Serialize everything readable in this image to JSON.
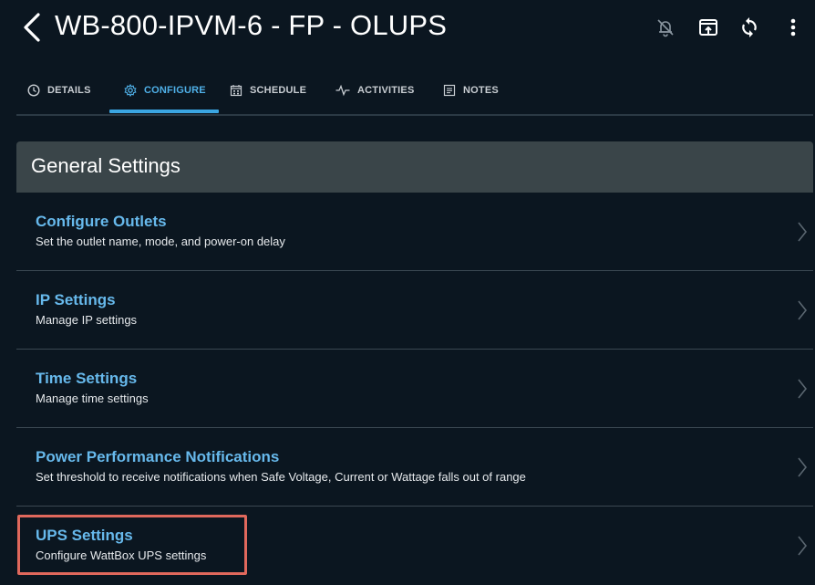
{
  "header": {
    "title": "WB-800-IPVM-6 - FP - OLUPS",
    "icons": [
      "back-icon",
      "bell-off-icon",
      "cast-icon",
      "refresh-icon",
      "more-vert-icon"
    ]
  },
  "tabs": [
    {
      "label": "DETAILS",
      "icon": "clock-icon",
      "active": false
    },
    {
      "label": "CONFIGURE",
      "icon": "gear-icon",
      "active": true
    },
    {
      "label": "SCHEDULE",
      "icon": "calendar-icon",
      "active": false
    },
    {
      "label": "ACTIVITIES",
      "icon": "pulse-icon",
      "active": false
    },
    {
      "label": "NOTES",
      "icon": "notes-icon",
      "active": false
    }
  ],
  "section": {
    "title": "General Settings",
    "items": [
      {
        "title": "Configure Outlets",
        "subtitle": "Set the outlet name, mode, and power-on delay"
      },
      {
        "title": "IP Settings",
        "subtitle": "Manage IP settings"
      },
      {
        "title": "Time Settings",
        "subtitle": "Manage time settings"
      },
      {
        "title": "Power Performance Notifications",
        "subtitle": "Set threshold to receive notifications when Safe Voltage, Current or Wattage falls out of range"
      },
      {
        "title": "UPS Settings",
        "subtitle": "Configure WattBox UPS settings",
        "highlighted": true
      }
    ]
  },
  "colors": {
    "background": "#0b1620",
    "accent": "#3ba6e2",
    "item_title": "#67b9ec",
    "section_header": "#3a4549",
    "highlight": "#e0685c"
  }
}
